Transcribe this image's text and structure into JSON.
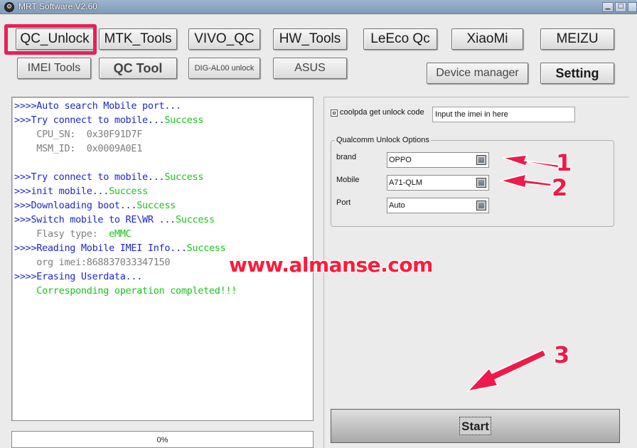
{
  "window": {
    "title": "MRT Software V2.60",
    "icon": "mrt-app-icon"
  },
  "toolbar": {
    "row1": [
      "QC_Unlock",
      "MTK_Tools",
      "VIVO_QC",
      "HW_Tools",
      "LeEco Qc",
      "XiaoMi",
      "MEIZU"
    ],
    "row2": [
      "IMEI Tools",
      "QC Tool",
      "DIG-AL00 unlock",
      "ASUS",
      "Device manager",
      "Setting"
    ]
  },
  "log": [
    {
      "text": ">>>>Auto search Mobile port...",
      "color": "blue"
    },
    {
      "text": ">>>Try connect to mobile...",
      "suffix": "Success"
    },
    {
      "text": "    CPU_SN:  0x30F91D7F",
      "color": "gray"
    },
    {
      "text": "    MSM_ID:  0x0009A0E1",
      "color": "gray"
    },
    {
      "text": ">>>Try connect to mobile...",
      "suffix": "Success"
    },
    {
      "text": ">>>init mobile...",
      "suffix": "Success"
    },
    {
      "text": ">>>Downloading boot...",
      "suffix": "Success"
    },
    {
      "text": ">>>Switch mobile to RE\\WR ...",
      "suffix": "Success"
    },
    {
      "text": "    Flasy type:  ",
      "color": "gray",
      "suffix_green": "eMMC"
    },
    {
      "text": ">>>>Reading Mobile IMEI Info...",
      "suffix": "Success"
    },
    {
      "text": "    org imei:868837033347150",
      "color": "gray"
    },
    {
      "text": ">>>>Erasing Userdata...",
      "color": "blue"
    },
    {
      "text": "    Corresponding operation completed!!!",
      "color": "green"
    }
  ],
  "progress": {
    "label": "0%",
    "value": 0
  },
  "coolpad": {
    "checkbox_label": "coolpda get unlock code",
    "imei_input_value": "Input the imei in here",
    "checked": false
  },
  "qualcomm": {
    "group_label": "Qualcomm Unlock Options",
    "brand_label": "brand",
    "brand_value": "OPPO",
    "mobile_label": "Mobile",
    "mobile_value": "A71-QLM",
    "port_label": "Port",
    "port_value": "Auto"
  },
  "start": {
    "label": "Start"
  },
  "overlay": {
    "watermark": "www.almanse.com",
    "step1": "1",
    "step2": "2",
    "step3": "3",
    "color": "#ef1a4a"
  }
}
